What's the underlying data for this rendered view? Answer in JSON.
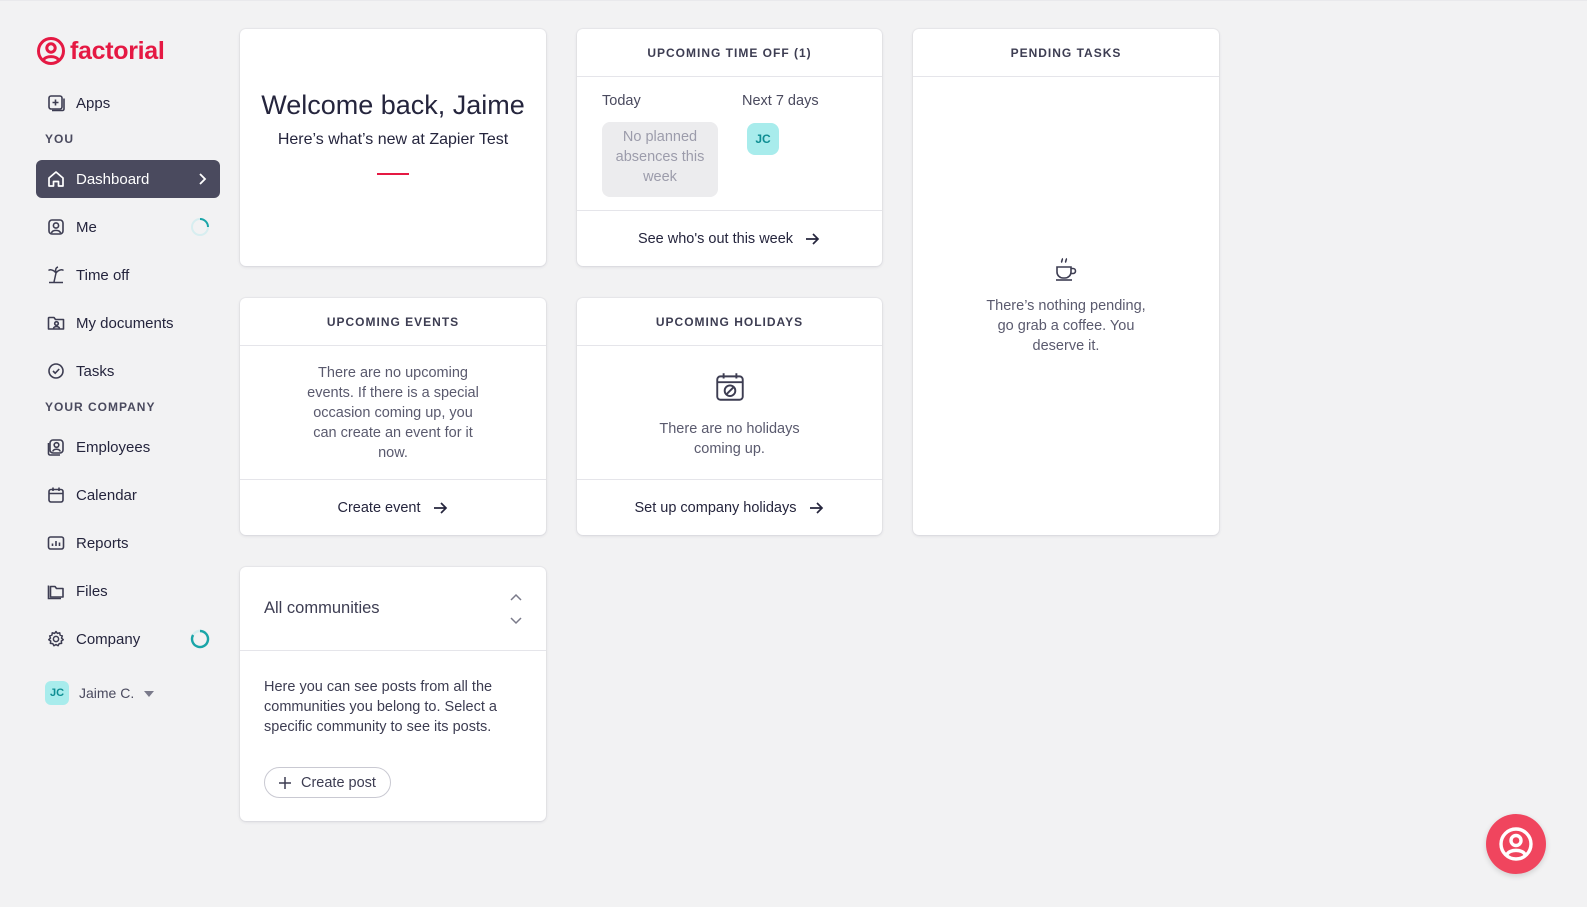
{
  "brand": {
    "name": "factorial",
    "color": "#e51943"
  },
  "sidebar": {
    "apps_label": "Apps",
    "section_you": "YOU",
    "section_company": "YOUR COMPANY",
    "items_you": [
      {
        "label": "Dashboard",
        "icon": "home-icon",
        "active": true
      },
      {
        "label": "Me",
        "icon": "user-icon"
      },
      {
        "label": "Time off",
        "icon": "palm-tree-icon"
      },
      {
        "label": "My documents",
        "icon": "folder-user-icon"
      },
      {
        "label": "Tasks",
        "icon": "check-circle-icon"
      }
    ],
    "items_company": [
      {
        "label": "Employees",
        "icon": "employees-icon"
      },
      {
        "label": "Calendar",
        "icon": "calendar-icon"
      },
      {
        "label": "Reports",
        "icon": "chart-icon"
      },
      {
        "label": "Files",
        "icon": "files-icon"
      },
      {
        "label": "Company",
        "icon": "gear-icon"
      }
    ],
    "user": {
      "initials": "JC",
      "name": "Jaime C."
    }
  },
  "welcome": {
    "title": "Welcome back, Jaime",
    "subtitle": "Here’s what’s new at Zapier Test"
  },
  "time_off": {
    "title": "UPCOMING TIME OFF (1)",
    "today_label": "Today",
    "next_label": "Next 7 days",
    "no_absences": "No planned absences this week",
    "person_initials": "JC",
    "footer": "See who's out this week"
  },
  "pending_tasks": {
    "title": "PENDING TASKS",
    "empty_text": "There’s nothing pending, go grab a coffee. You deserve it."
  },
  "events": {
    "title": "UPCOMING EVENTS",
    "empty_text": "There are no upcoming events. If there is a special occasion coming up, you can create an event for it now.",
    "footer": "Create event"
  },
  "holidays": {
    "title": "UPCOMING HOLIDAYS",
    "empty_text": "There are no holidays coming up.",
    "footer": "Set up company holidays"
  },
  "communities": {
    "selected": "All communities",
    "description": "Here you can see posts from all the communities you belong to. Select a specific community to see its posts.",
    "create_label": "Create post"
  },
  "colors": {
    "accent": "#e51943",
    "active_nav": "#4a4a5e",
    "teal": "#1aa5a8",
    "fab": "#f0455e"
  }
}
